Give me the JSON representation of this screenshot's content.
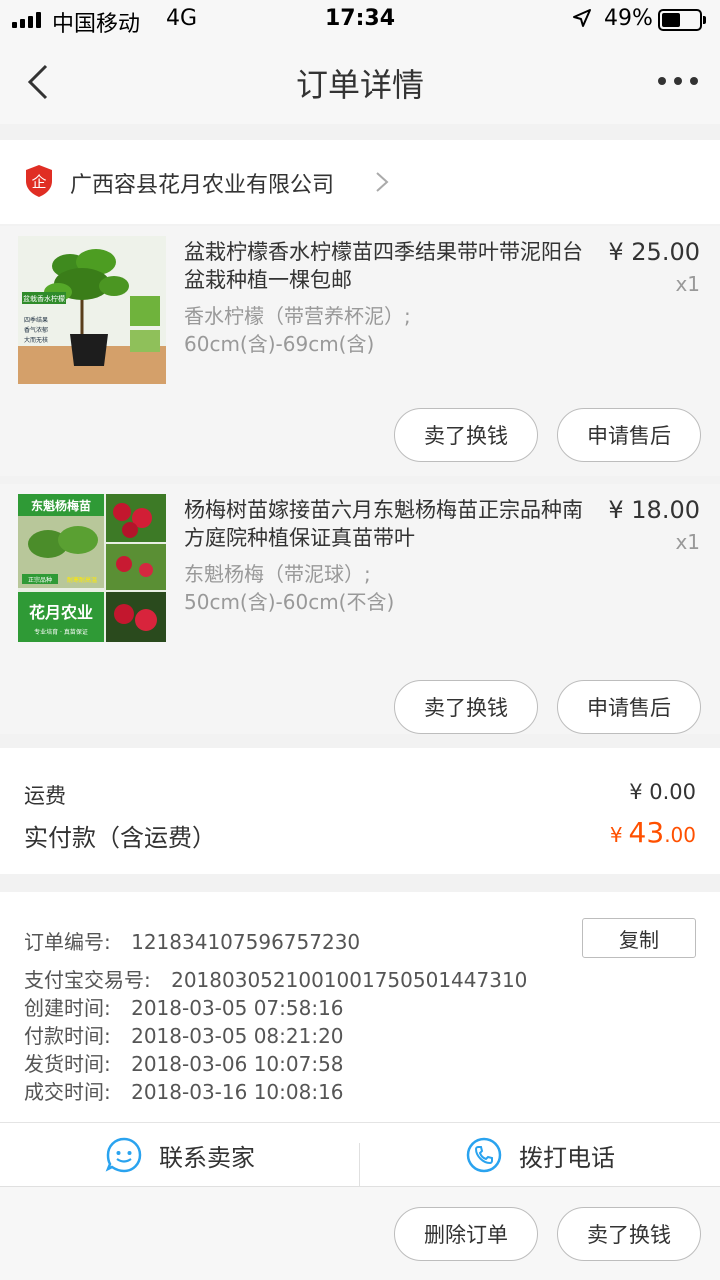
{
  "status_bar": {
    "carrier": "中国移动",
    "network": "4G",
    "time": "17:34",
    "battery": "49%",
    "battery_level": 0.49
  },
  "nav": {
    "title": "订单详情",
    "back_icon": "chevron-left-icon",
    "more_icon": "more-icon"
  },
  "shop": {
    "name": "广西容县花月农业有限公司",
    "badge_char": "企",
    "badge_color": "#e02e24"
  },
  "items": [
    {
      "title": "盆栽柠檬香水柠檬苗四季结果带叶带泥阳台盆栽种植一棵包邮",
      "price": "¥ 25.00",
      "qty": "x1",
      "sku_line1": "香水柠檬（带营养杯泥）;",
      "sku_line2": "60cm(含)-69cm(含)",
      "thumb_labels": [
        "盆栽香水柠檬",
        "四季结果",
        "香气浓郁",
        "大而无核"
      ],
      "btn_sell": "卖了换钱",
      "btn_aftersale": "申请售后"
    },
    {
      "title": "杨梅树苗嫁接苗六月东魁杨梅苗正宗品种南方庭院种植保证真苗带叶",
      "price": "¥ 18.00",
      "qty": "x1",
      "sku_line1": "东魁杨梅（带泥球）;",
      "sku_line2": "50cm(含)-60cm(不含)",
      "thumb_labels": [
        "东魁杨梅苗",
        "正宗品种",
        "耐寒耐高温",
        "花月农业",
        "专业培育 · 真苗保证"
      ],
      "btn_sell": "卖了换钱",
      "btn_aftersale": "申请售后"
    }
  ],
  "fees": {
    "shipping_label": "运费",
    "shipping_value": "¥ 0.00",
    "paid_label": "实付款（含运费）",
    "paid_currency": "¥",
    "paid_int": "43",
    "paid_dec": ".00",
    "accent": "#ff5000"
  },
  "order_info": {
    "order_no_label": "订单编号:",
    "order_no": "1218341075967572​30",
    "copy_label": "复制",
    "alipay_label": "支付宝交易号:",
    "alipay_no": "2018030521001001750501447310",
    "created_label": "创建时间:",
    "created": "2018-03-05 07:58:16",
    "paid_label": "付款时间:",
    "paid": "2018-03-05 08:21:20",
    "shipped_label": "发货时间:",
    "shipped": "2018-03-06 10:07:58",
    "done_label": "成交时间:",
    "done": "2018-03-16 10:08:16"
  },
  "contact": {
    "seller_label": "联系卖家",
    "phone_label": "拨打电话",
    "icon_color": "#2aa3ef"
  },
  "bottom": {
    "delete_label": "删除订单",
    "sell_label": "卖了换钱"
  }
}
